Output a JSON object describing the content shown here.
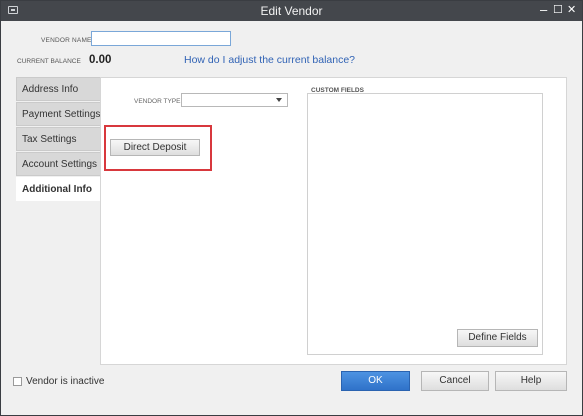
{
  "window": {
    "title": "Edit Vendor",
    "controls": {
      "minimize": "–",
      "maximize": "☐",
      "close": "✕"
    },
    "icon": "window-icon"
  },
  "header": {
    "vendor_name_label": "VENDOR NAME",
    "vendor_name_value": "",
    "current_balance_label": "CURRENT BALANCE",
    "current_balance_value": "0.00",
    "balance_help_link": "How do I adjust the current balance?"
  },
  "tabs": [
    {
      "label": "Address Info",
      "active": false
    },
    {
      "label": "Payment Settings",
      "active": false
    },
    {
      "label": "Tax Settings",
      "active": false
    },
    {
      "label": "Account Settings",
      "active": false
    },
    {
      "label": "Additional Info",
      "active": true
    }
  ],
  "additional_info": {
    "vendor_type_label": "VENDOR TYPE",
    "vendor_type_value": "",
    "direct_deposit_button": "Direct Deposit",
    "custom_fields_title": "CUSTOM FIELDS",
    "define_fields_button": "Define Fields"
  },
  "footer": {
    "vendor_inactive_label": "Vendor is inactive",
    "vendor_inactive_checked": false,
    "ok_button": "OK",
    "cancel_button": "Cancel",
    "help_button": "Help"
  },
  "colors": {
    "titlebar": "#44474c",
    "ok_button": "#3a80d4",
    "link": "#3163b5",
    "highlight_border": "#d8383d"
  }
}
